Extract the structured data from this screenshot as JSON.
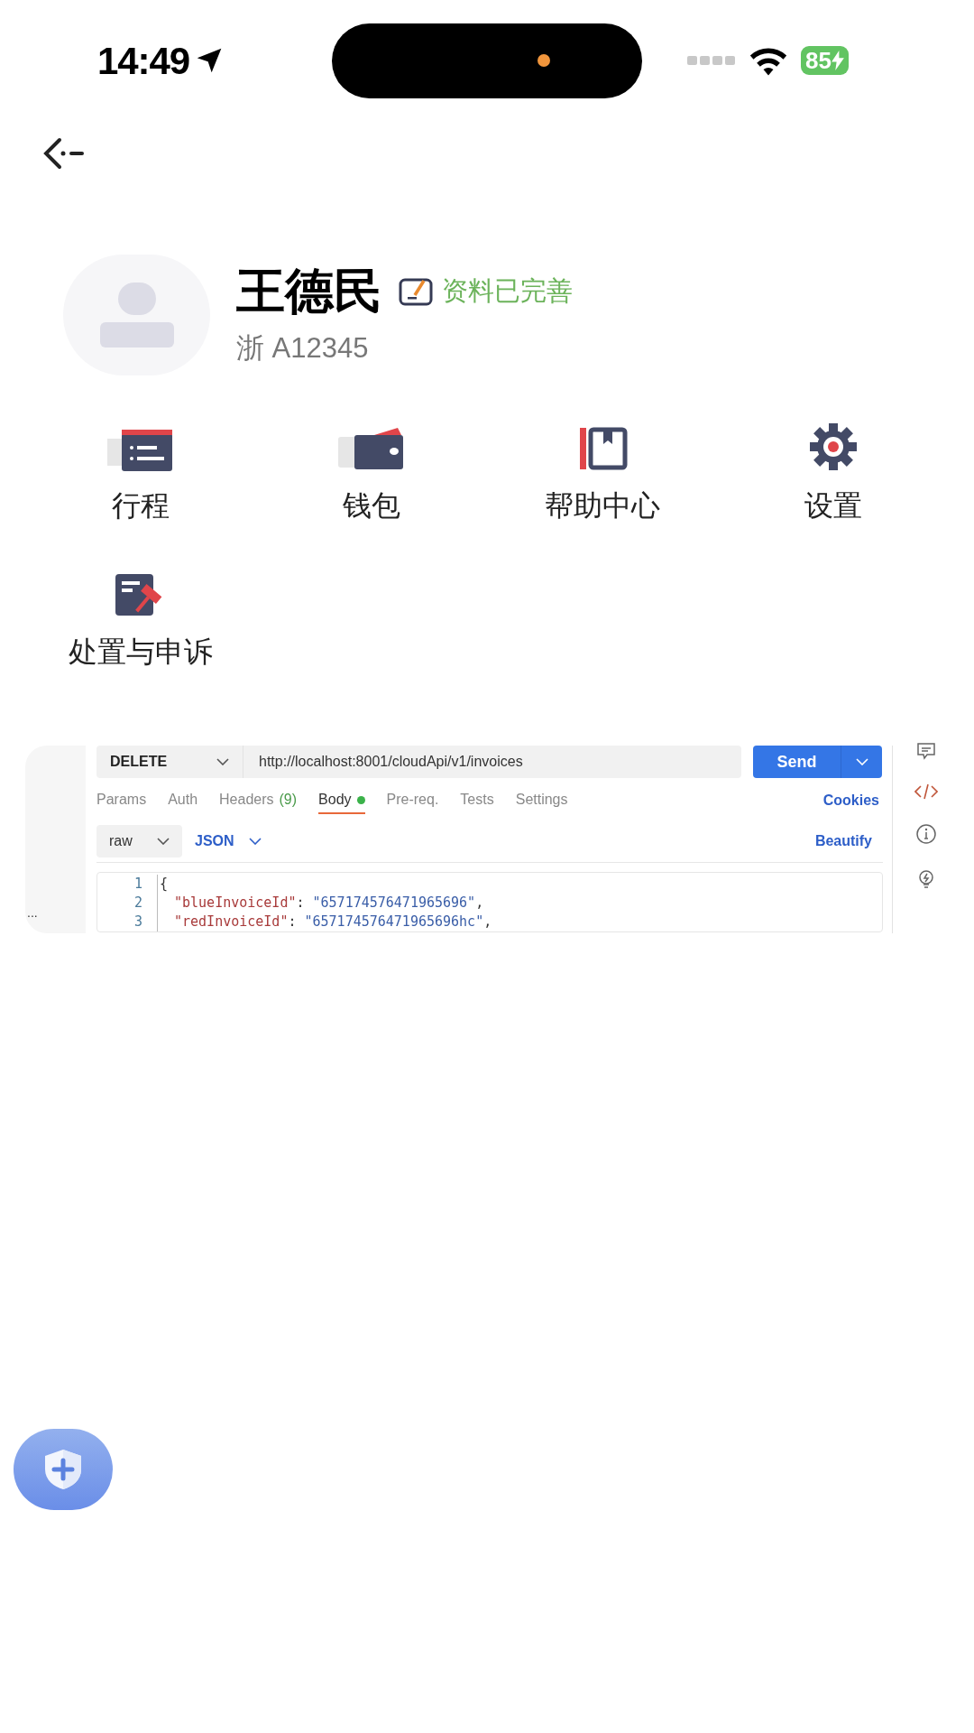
{
  "status_bar": {
    "time": "14:49",
    "battery": "85"
  },
  "profile": {
    "name": "王德民",
    "status": "资料已完善",
    "plate": "浙 A12345"
  },
  "menu": {
    "items": [
      {
        "kind": "trips",
        "label": "行程"
      },
      {
        "kind": "wallet",
        "label": "钱包"
      },
      {
        "kind": "help",
        "label": "帮助中心"
      },
      {
        "kind": "settings",
        "label": "设置"
      },
      {
        "kind": "appeal",
        "label": "处置与申诉"
      }
    ]
  },
  "embedded_screenshot": {
    "side_label": "...",
    "method": "DELETE",
    "url": "http://localhost:8001/cloudApi/v1/invoices",
    "send": "Send",
    "tabs": [
      {
        "label": "Params",
        "selected": false
      },
      {
        "label": "Auth",
        "selected": false
      },
      {
        "label": "Headers",
        "count": "(9)",
        "selected": false
      },
      {
        "label": "Body",
        "selected": true,
        "has_content": true
      },
      {
        "label": "Pre-req.",
        "selected": false
      },
      {
        "label": "Tests",
        "selected": false
      },
      {
        "label": "Settings",
        "selected": false
      }
    ],
    "cookies": "Cookies",
    "body_type": "raw",
    "format": "JSON",
    "beautify": "Beautify",
    "code_lines": [
      {
        "number": "1",
        "kind": "brace",
        "text": "{"
      },
      {
        "number": "2",
        "kind": "pair",
        "key": "\"blueInvoiceId\"",
        "colon": ":",
        "value": "\"657174576471965696\"",
        "comma": ","
      },
      {
        "number": "3",
        "kind": "pair",
        "key": "\"redInvoiceId\"",
        "colon": ":",
        "value": "\"657174576471965696hc\"",
        "comma": ","
      }
    ]
  }
}
